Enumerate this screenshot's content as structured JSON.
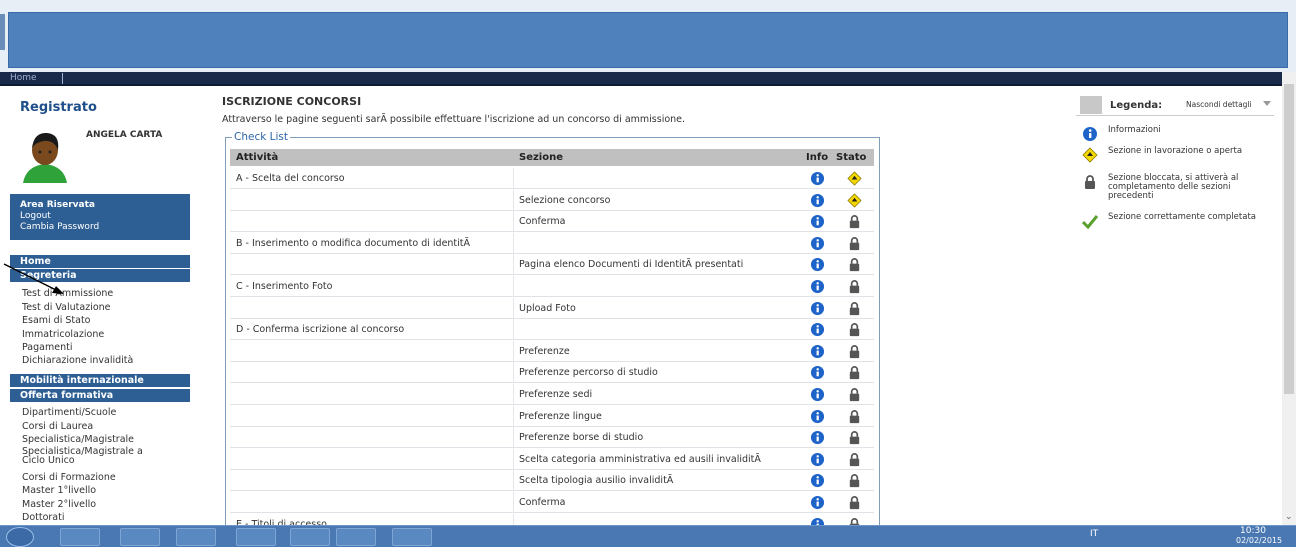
{
  "topnav": {
    "home": "Home"
  },
  "sidebar": {
    "title": "Registrato",
    "user_name": "ANGELA CARTA",
    "reserved": {
      "area": "Area Riservata",
      "logout": "Logout",
      "password": "Cambia Password"
    },
    "home": "Home",
    "segreteria": {
      "label": "Segreteria",
      "items": [
        "Test di Ammissione",
        "Test di Valutazione",
        "Esami di Stato",
        "Immatricolazione",
        "Pagamenti",
        "Dichiarazione invalidità"
      ]
    },
    "mobilita": "Mobilità internazionale",
    "offerta": {
      "label": "Offerta formativa",
      "items": [
        "Dipartimenti/Scuole",
        "Corsi di Laurea",
        "Specialistica/Magistrale",
        "Specialistica/Magistrale a\nCiclo Unico",
        "Corsi di Formazione",
        "Master 1°livello",
        "Master 2°livello",
        "Dottorati"
      ]
    }
  },
  "main": {
    "title": "ISCRIZIONE CONCORSI",
    "intro": "Attraverso le pagine seguenti sarÃ  possibile effettuare l'iscrizione ad un concorso di ammissione.",
    "checklist_label": "Check List",
    "columns": {
      "attivita": "Attività",
      "sezione": "Sezione",
      "info": "Info",
      "stato": "Stato"
    },
    "rows": [
      {
        "act": "A - Scelta del concorso",
        "sec": "",
        "stato": "open"
      },
      {
        "act": "",
        "sec": "Selezione concorso",
        "stato": "open"
      },
      {
        "act": "",
        "sec": "Conferma",
        "stato": "locked"
      },
      {
        "act": "B - Inserimento o modifica documento di identitÃ",
        "sec": "",
        "stato": "locked"
      },
      {
        "act": "",
        "sec": "Pagina elenco Documenti di IdentitÃ  presentati",
        "stato": "locked"
      },
      {
        "act": "C - Inserimento Foto",
        "sec": "",
        "stato": "locked"
      },
      {
        "act": "",
        "sec": "Upload Foto",
        "stato": "locked"
      },
      {
        "act": "D - Conferma iscrizione al concorso",
        "sec": "",
        "stato": "locked"
      },
      {
        "act": "",
        "sec": "Preferenze",
        "stato": "locked"
      },
      {
        "act": "",
        "sec": "Preferenze percorso di studio",
        "stato": "locked"
      },
      {
        "act": "",
        "sec": "Preferenze sedi",
        "stato": "locked"
      },
      {
        "act": "",
        "sec": "Preferenze lingue",
        "stato": "locked"
      },
      {
        "act": "",
        "sec": "Preferenze borse di studio",
        "stato": "locked"
      },
      {
        "act": "",
        "sec": "Scelta categoria amministrativa ed ausili invaliditÃ",
        "stato": "locked"
      },
      {
        "act": "",
        "sec": "Scelta tipologia ausilio invaliditÃ",
        "stato": "locked"
      },
      {
        "act": "",
        "sec": "Conferma",
        "stato": "locked"
      },
      {
        "act": "E - Titoli di accesso",
        "sec": "",
        "stato": "locked"
      }
    ]
  },
  "legend": {
    "title": "Legenda:",
    "toggle": "Nascondi dettagli",
    "items": [
      {
        "icon": "info-icon",
        "text": "Informazioni"
      },
      {
        "icon": "open-section-icon",
        "text": "Sezione in lavorazione o aperta"
      },
      {
        "icon": "lock-icon",
        "text": "Sezione bloccata, si attiverà al completamento delle sezioni precedenti"
      },
      {
        "icon": "check-icon",
        "text": "Sezione correttamente completata"
      }
    ]
  },
  "taskbar": {
    "tray_lang": "IT",
    "time": "10:30",
    "date": "02/02/2015"
  },
  "colors": {
    "banner": "#4f81bd",
    "sidebar_block": "#2e5f94",
    "info_blue": "#1e64c8",
    "open_yellow": "#f5d800"
  }
}
